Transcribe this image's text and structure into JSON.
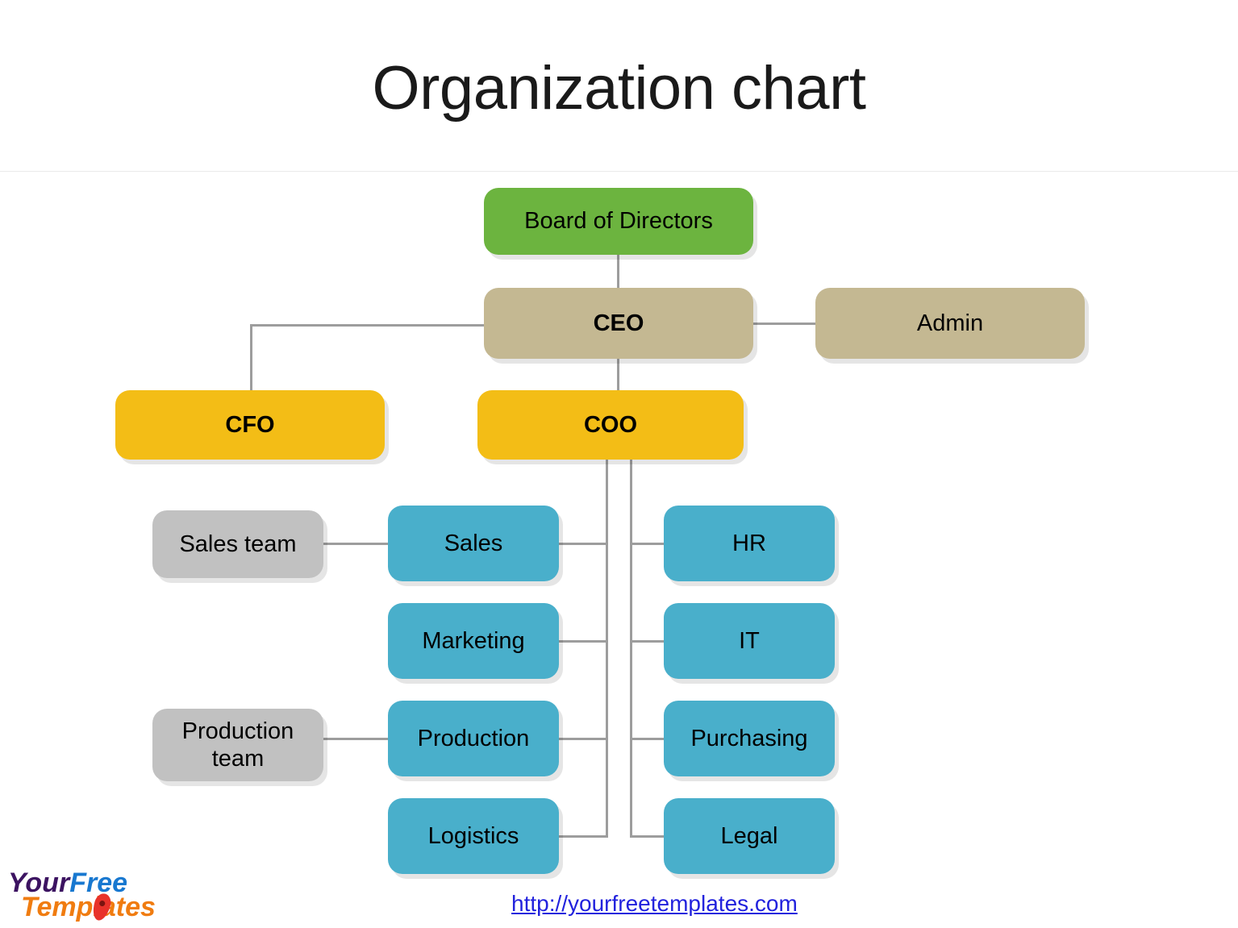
{
  "slide": {
    "title": "Organization chart",
    "background": "#FFFFFF"
  },
  "colors": {
    "green": "#6CB43F",
    "tan": "#C4B892",
    "yellow": "#F3BD16",
    "blue": "#49AFCB",
    "gray": "#C1C1C1",
    "connector": "#9D9D9D",
    "link": "#2222DD",
    "divider": "#EAEAEA"
  },
  "chart_data": {
    "type": "diagram",
    "diagram_kind": "organization-chart",
    "title": "Organization chart",
    "nodes": [
      {
        "id": "board",
        "label": "Board of Directors",
        "color": "#6CB43F",
        "bold": false,
        "level": 0,
        "column": "center"
      },
      {
        "id": "ceo",
        "label": "CEO",
        "color": "#C4B892",
        "bold": true,
        "level": 1,
        "column": "center"
      },
      {
        "id": "admin",
        "label": "Admin",
        "color": "#C4B892",
        "bold": false,
        "level": 1,
        "column": "right"
      },
      {
        "id": "cfo",
        "label": "CFO",
        "color": "#F3BD16",
        "bold": true,
        "level": 2,
        "column": "left"
      },
      {
        "id": "coo",
        "label": "COO",
        "color": "#F3BD16",
        "bold": true,
        "level": 2,
        "column": "center"
      },
      {
        "id": "sales",
        "label": "Sales",
        "color": "#49AFCB",
        "bold": false,
        "level": 3,
        "column": "inner-left"
      },
      {
        "id": "marketing",
        "label": "Marketing",
        "color": "#49AFCB",
        "bold": false,
        "level": 3,
        "column": "inner-left"
      },
      {
        "id": "production",
        "label": "Production",
        "color": "#49AFCB",
        "bold": false,
        "level": 3,
        "column": "inner-left"
      },
      {
        "id": "logistics",
        "label": "Logistics",
        "color": "#49AFCB",
        "bold": false,
        "level": 3,
        "column": "inner-left"
      },
      {
        "id": "hr",
        "label": "HR",
        "color": "#49AFCB",
        "bold": false,
        "level": 3,
        "column": "inner-right"
      },
      {
        "id": "it",
        "label": "IT",
        "color": "#49AFCB",
        "bold": false,
        "level": 3,
        "column": "inner-right"
      },
      {
        "id": "purchasing",
        "label": "Purchasing",
        "color": "#49AFCB",
        "bold": false,
        "level": 3,
        "column": "inner-right"
      },
      {
        "id": "legal",
        "label": "Legal",
        "color": "#49AFCB",
        "bold": false,
        "level": 3,
        "column": "inner-right"
      },
      {
        "id": "sales-team",
        "label": "Sales team",
        "color": "#C1C1C1",
        "bold": false,
        "level": 4,
        "column": "outer-left"
      },
      {
        "id": "production-team",
        "label": "Production\nteam",
        "color": "#C1C1C1",
        "bold": false,
        "level": 4,
        "column": "outer-left"
      }
    ],
    "edges": [
      {
        "from": "board",
        "to": "ceo"
      },
      {
        "from": "ceo",
        "to": "admin"
      },
      {
        "from": "ceo",
        "to": "cfo"
      },
      {
        "from": "ceo",
        "to": "coo"
      },
      {
        "from": "coo",
        "to": "sales"
      },
      {
        "from": "coo",
        "to": "marketing"
      },
      {
        "from": "coo",
        "to": "production"
      },
      {
        "from": "coo",
        "to": "logistics"
      },
      {
        "from": "coo",
        "to": "hr"
      },
      {
        "from": "coo",
        "to": "it"
      },
      {
        "from": "coo",
        "to": "purchasing"
      },
      {
        "from": "coo",
        "to": "legal"
      },
      {
        "from": "sales",
        "to": "sales-team"
      },
      {
        "from": "production",
        "to": "production-team"
      }
    ]
  },
  "nodes": {
    "board": {
      "label": "Board of Directors"
    },
    "ceo": {
      "label": "CEO"
    },
    "admin": {
      "label": "Admin"
    },
    "cfo": {
      "label": "CFO"
    },
    "coo": {
      "label": "COO"
    },
    "sales": {
      "label": "Sales"
    },
    "marketing": {
      "label": "Marketing"
    },
    "production": {
      "label": "Production"
    },
    "logistics": {
      "label": "Logistics"
    },
    "hr": {
      "label": "HR"
    },
    "it": {
      "label": "IT"
    },
    "purchasing": {
      "label": "Purchasing"
    },
    "legal": {
      "label": "Legal"
    },
    "sales_team": {
      "label": "Sales team"
    },
    "production_team": {
      "label": "Production team"
    }
  },
  "footer": {
    "url": "http://yourfreetemplates.com"
  },
  "logo": {
    "word1": "Your",
    "word2": "Free",
    "word3": "Templates"
  }
}
